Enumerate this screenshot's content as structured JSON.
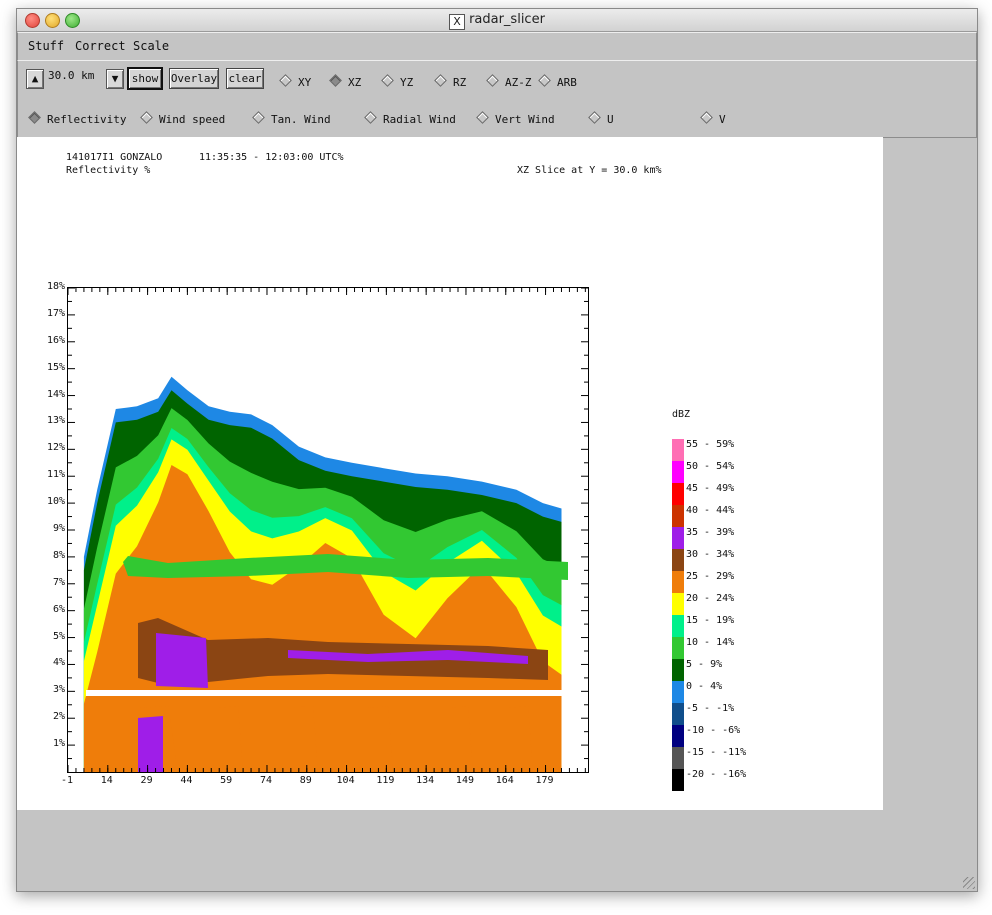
{
  "window": {
    "title": "radar_slicer"
  },
  "menubar": {
    "items": [
      "Stuff",
      "Correct",
      "Scale"
    ]
  },
  "toolbar": {
    "distance": "30.0 km",
    "buttons": {
      "show": "show",
      "overlay": "Overlay",
      "clear": "clear"
    },
    "up_glyph": "▲",
    "down_glyph": "▼",
    "slice_options": [
      "XY",
      "XZ",
      "YZ",
      "RZ",
      "AZ-Z",
      "ARB"
    ],
    "selected_slice": "XZ",
    "field_options": [
      "Reflectivity",
      "Wind speed",
      "Tan. Wind",
      "Radial Wind",
      "Vert Wind",
      "U",
      "V"
    ],
    "selected_field": "Reflectivity"
  },
  "plot_header": {
    "storm": "141017I1 GONZALO",
    "time": "11:35:35 - 12:03:00 UTC%",
    "field": "Reflectivity %",
    "slice": "XZ Slice at Y = 30.0 km%"
  },
  "chart_data": {
    "type": "heatmap",
    "title": "",
    "x_tick_labels": [
      "-1",
      "14",
      "29",
      "44",
      "59",
      "74",
      "89",
      "104",
      "119",
      "134",
      "149",
      "164",
      "179"
    ],
    "x_ticks": [
      -1,
      14,
      29,
      44,
      59,
      74,
      89,
      104,
      119,
      134,
      149,
      164,
      179
    ],
    "y_tick_labels": [
      "1%",
      "2%",
      "3%",
      "4%",
      "5%",
      "6%",
      "7%",
      "8%",
      "9%",
      "10%",
      "11%",
      "12%",
      "13%",
      "14%",
      "15%",
      "16%",
      "17%",
      "18%"
    ],
    "y_ticks": [
      1,
      2,
      3,
      4,
      5,
      6,
      7,
      8,
      9,
      10,
      11,
      12,
      13,
      14,
      15,
      16,
      17,
      18
    ],
    "xlim": [
      -1,
      195
    ],
    "ylim": [
      0,
      18
    ],
    "echo_top_profile": [
      [
        5,
        8.0
      ],
      [
        10,
        10.5
      ],
      [
        17,
        13.5
      ],
      [
        25,
        13.6
      ],
      [
        33,
        13.9
      ],
      [
        38,
        14.7
      ],
      [
        44,
        14.2
      ],
      [
        52,
        13.6
      ],
      [
        60,
        13.4
      ],
      [
        68,
        13.3
      ],
      [
        76,
        12.9
      ],
      [
        86,
        12.1
      ],
      [
        96,
        11.7
      ],
      [
        106,
        11.5
      ],
      [
        118,
        11.3
      ],
      [
        130,
        11.1
      ],
      [
        142,
        11.0
      ],
      [
        155,
        10.8
      ],
      [
        168,
        10.5
      ],
      [
        178,
        10.0
      ],
      [
        185,
        9.8
      ]
    ],
    "legend_title": "dBZ",
    "legend": [
      {
        "label": "55 - 59%",
        "color": "#ff6eb4"
      },
      {
        "label": "50 - 54%",
        "color": "#ff00ff"
      },
      {
        "label": "45 - 49%",
        "color": "#ff0000"
      },
      {
        "label": "40 - 44%",
        "color": "#cc3300"
      },
      {
        "label": "35 - 39%",
        "color": "#9f1ee8"
      },
      {
        "label": "30 - 34%",
        "color": "#8b4513"
      },
      {
        "label": "25 - 29%",
        "color": "#ef7d0a"
      },
      {
        "label": "20 - 24%",
        "color": "#ffff00"
      },
      {
        "label": "15 - 19%",
        "color": "#00f08a"
      },
      {
        "label": "10 - 14%",
        "color": "#32c832"
      },
      {
        "label": "5 - 9%",
        "color": "#006400"
      },
      {
        "label": "0 - 4%",
        "color": "#1e88e5"
      },
      {
        "label": "-5 - -1%",
        "color": "#104e8b"
      },
      {
        "label": "-10 - -6%",
        "color": "#000080"
      },
      {
        "label": "-15 - -11%",
        "color": "#555555"
      },
      {
        "label": "-20 - -16%",
        "color": "#000000"
      }
    ]
  }
}
